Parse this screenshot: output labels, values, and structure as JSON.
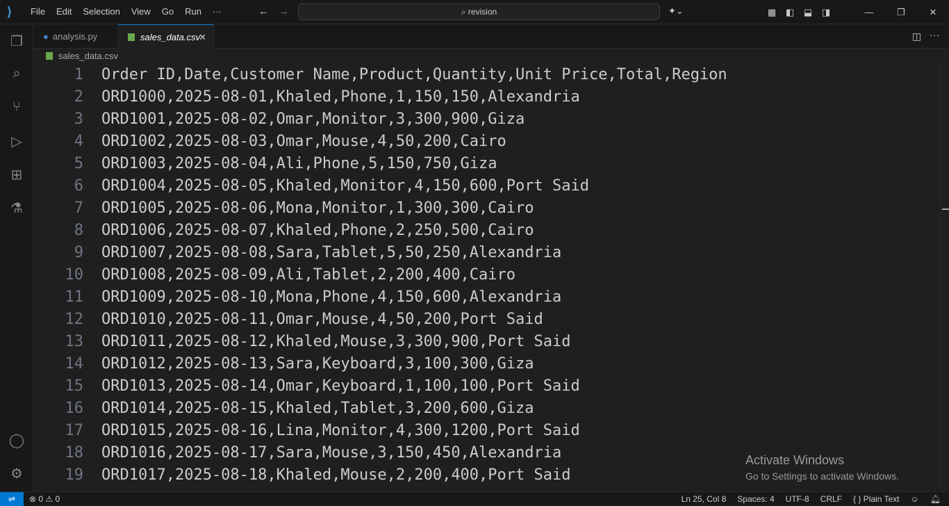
{
  "titlebar": {
    "menu": [
      "File",
      "Edit",
      "Selection",
      "View",
      "Go",
      "Run",
      "···"
    ],
    "search": "revision"
  },
  "tabs": [
    {
      "label": "analysis.py"
    },
    {
      "label": "sales_data.csv"
    }
  ],
  "breadcrumb": "sales_data.csv",
  "lines": [
    "Order ID,Date,Customer Name,Product,Quantity,Unit Price,Total,Region",
    "ORD1000,2025-08-01,Khaled,Phone,1,150,150,Alexandria",
    "ORD1001,2025-08-02,Omar,Monitor,3,300,900,Giza",
    "ORD1002,2025-08-03,Omar,Mouse,4,50,200,Cairo",
    "ORD1003,2025-08-04,Ali,Phone,5,150,750,Giza",
    "ORD1004,2025-08-05,Khaled,Monitor,4,150,600,Port Said",
    "ORD1005,2025-08-06,Mona,Monitor,1,300,300,Cairo",
    "ORD1006,2025-08-07,Khaled,Phone,2,250,500,Cairo",
    "ORD1007,2025-08-08,Sara,Tablet,5,50,250,Alexandria",
    "ORD1008,2025-08-09,Ali,Tablet,2,200,400,Cairo",
    "ORD1009,2025-08-10,Mona,Phone,4,150,600,Alexandria",
    "ORD1010,2025-08-11,Omar,Mouse,4,50,200,Port Said",
    "ORD1011,2025-08-12,Khaled,Mouse,3,300,900,Port Said",
    "ORD1012,2025-08-13,Sara,Keyboard,3,100,300,Giza",
    "ORD1013,2025-08-14,Omar,Keyboard,1,100,100,Port Said",
    "ORD1014,2025-08-15,Khaled,Tablet,3,200,600,Giza",
    "ORD1015,2025-08-16,Lina,Monitor,4,300,1200,Port Said",
    "ORD1016,2025-08-17,Sara,Mouse,3,150,450,Alexandria",
    "ORD1017,2025-08-18,Khaled,Mouse,2,200,400,Port Said"
  ],
  "activation": {
    "title": "Activate Windows",
    "subtitle": "Go to Settings to activate Windows."
  },
  "status": {
    "problems": "⊗ 0 ⚠ 0",
    "position": "Ln 25, Col 8",
    "spaces": "Spaces: 4",
    "encoding": "UTF-8",
    "eol": "CRLF",
    "language": "{ }  Plain Text"
  }
}
